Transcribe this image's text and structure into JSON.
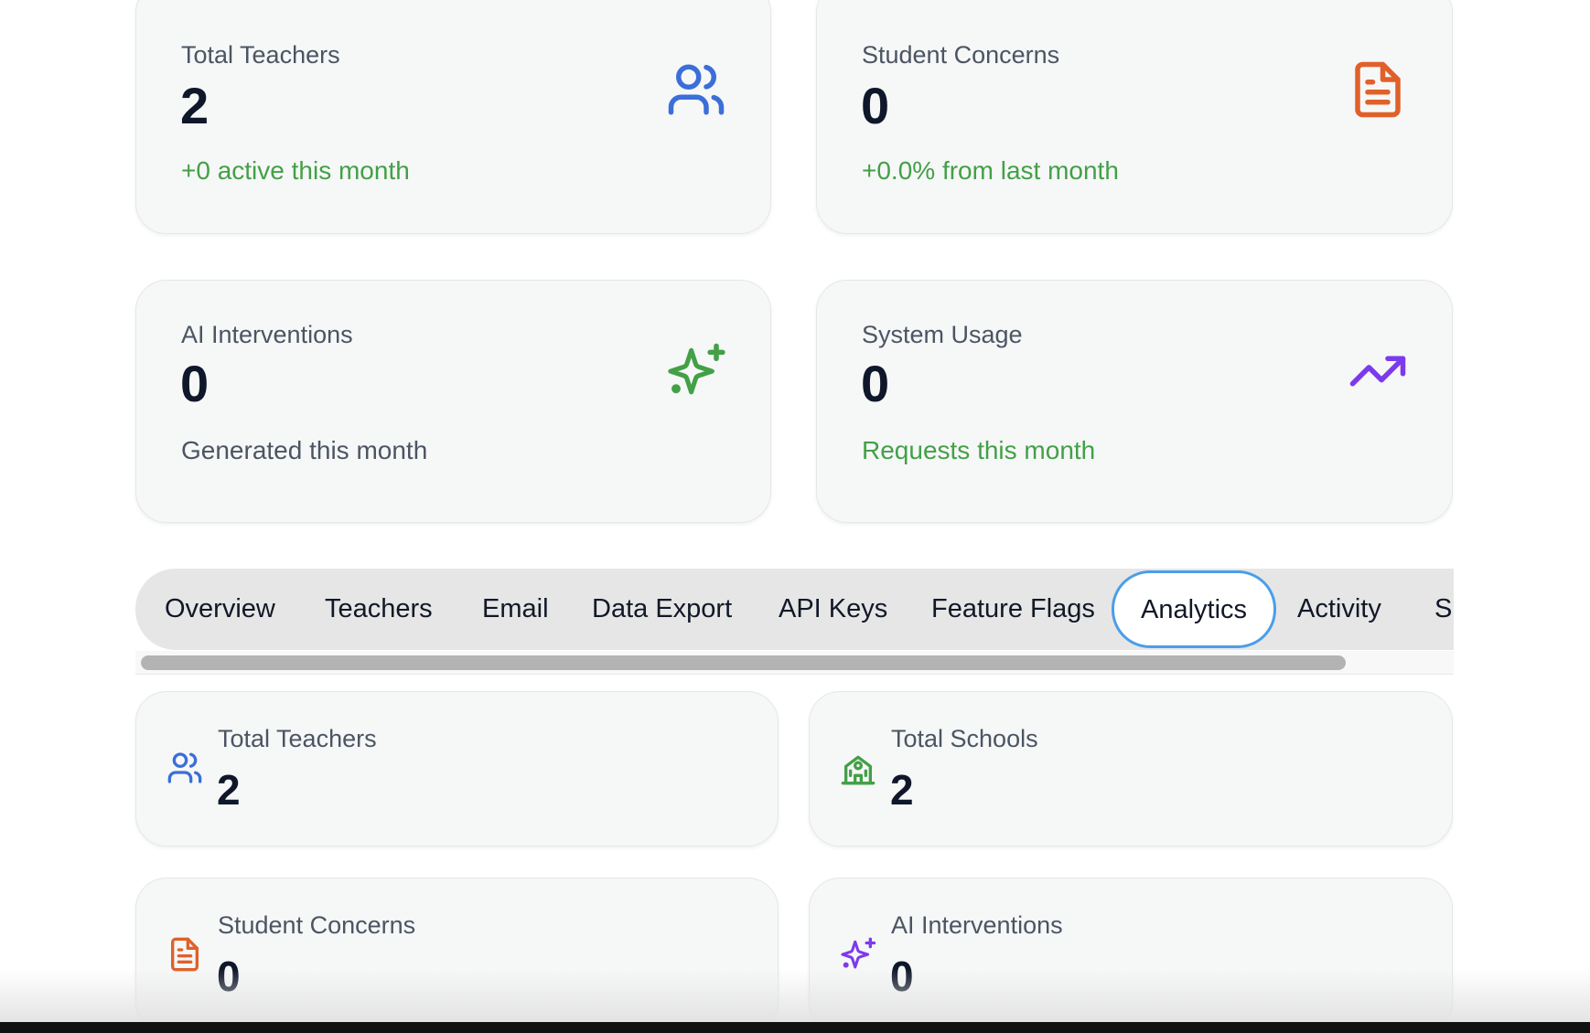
{
  "top_cards": [
    {
      "label": "Total Teachers",
      "value": "2",
      "sub": "+0 active this month",
      "icon": "users-icon",
      "icon_color": "#3b6fd8"
    },
    {
      "label": "Student Concerns",
      "value": "0",
      "sub": "+0.0% from last month",
      "icon": "document-icon",
      "icon_color": "#e0602a"
    },
    {
      "label": "AI Interventions",
      "value": "0",
      "sub": "Generated this month",
      "icon": "sparkles-icon",
      "icon_color": "#43a047"
    },
    {
      "label": "System Usage",
      "value": "0",
      "sub": "Requests this month",
      "icon": "trending-up-icon",
      "icon_color": "#7c3aed"
    }
  ],
  "colors": {
    "positive": "#43a047",
    "tab_focus_ring": "#4a9ee8"
  },
  "tabs": [
    {
      "label": "Overview"
    },
    {
      "label": "Teachers"
    },
    {
      "label": "Email"
    },
    {
      "label": "Data Export"
    },
    {
      "label": "API Keys"
    },
    {
      "label": "Feature Flags"
    },
    {
      "label": "Analytics",
      "active": true
    },
    {
      "label": "Activity"
    },
    {
      "label": "S"
    }
  ],
  "analytics_cards": [
    {
      "label": "Total Teachers",
      "value": "2",
      "icon": "users-icon",
      "icon_color": "#3b6fd8"
    },
    {
      "label": "Total Schools",
      "value": "2",
      "icon": "school-icon",
      "icon_color": "#43a047"
    },
    {
      "label": "Student Concerns",
      "value": "0",
      "icon": "document-icon",
      "icon_color": "#e0602a"
    },
    {
      "label": "AI Interventions",
      "value": "0",
      "icon": "sparkles-icon",
      "icon_color": "#7c3aed"
    }
  ]
}
